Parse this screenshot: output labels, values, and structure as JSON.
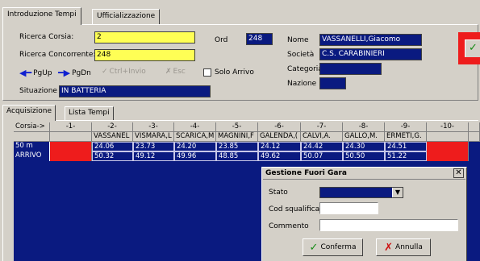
{
  "tabs": [
    "Introduzione Tempi",
    "Ufficializzazione"
  ],
  "form": {
    "ricerca_corsia_label": "Ricerca Corsia:",
    "ricerca_corsia_value": "2",
    "ricerca_concorrente_label": "Ricerca Concorrente:",
    "ricerca_concorrente_value": "248",
    "ord_label": "Ord",
    "ord_value": "248",
    "nome_label": "Nome",
    "nome_value": "VASSANELLI,Giacomo",
    "societa_label": "Società",
    "societa_value": "C.S. CARABINIERI",
    "categoria_label": "Categoria",
    "categoria_value": "",
    "nazione_label": "Nazione",
    "nazione_value": "",
    "situazione_label": "Situazione",
    "situazione_value": "IN BATTERIA"
  },
  "nav": {
    "pgup": "PgUp",
    "pgdn": "PgDn",
    "ctrl_invio": "Ctrl+Invio",
    "esc": "Esc",
    "solo_arrivo": "Solo Arrivo"
  },
  "subtabs": [
    "Acquisizione",
    "Lista Tempi"
  ],
  "grid": {
    "corner": "Corsia->",
    "lanes": [
      "-1-",
      "-2-",
      "-3-",
      "-4-",
      "-5-",
      "-6-",
      "-7-",
      "-8-",
      "-9-",
      "-10-"
    ],
    "names": [
      "",
      "VASSANEL",
      "VISMARA,L",
      "SCARICA,M",
      "MAGNINI,F",
      "GALENDA,(",
      "CALVI,A.",
      "GALLO,M.",
      "ERMETI,G.",
      ""
    ],
    "rows": [
      {
        "label": "50 m",
        "values": [
          "",
          "24.06",
          "23.73",
          "24.20",
          "23.85",
          "24.12",
          "24.42",
          "24.30",
          "24.51",
          ""
        ]
      },
      {
        "label": "ARRIVO",
        "values": [
          "",
          "50.32",
          "49.12",
          "49.96",
          "48.85",
          "49.62",
          "50.07",
          "50.50",
          "51.22",
          ""
        ]
      }
    ]
  },
  "dialog": {
    "title": "Gestione Fuori Gara",
    "stato_label": "Stato",
    "cod_label": "Cod squalifica",
    "commento_label": "Commento",
    "conferma": "Conferma",
    "annulla": "Annulla"
  }
}
